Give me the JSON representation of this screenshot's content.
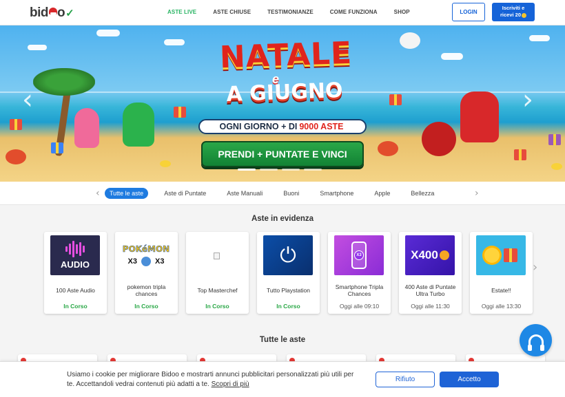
{
  "header": {
    "logo_text": "bid",
    "nav": [
      {
        "label": "ASTE LIVE",
        "active": true
      },
      {
        "label": "ASTE CHIUSE",
        "active": false
      },
      {
        "label": "TESTIMONIANZE",
        "active": false
      },
      {
        "label": "COME FUNZIONA",
        "active": false
      },
      {
        "label": "SHOP",
        "active": false
      }
    ],
    "login_label": "LOGIN",
    "signup_line1": "Iscriviti e",
    "signup_line2": "ricevi 20"
  },
  "banner": {
    "title": "NATALE",
    "title_e": "e",
    "subtitle": "A GIUGNO",
    "daily_prefix": "OGNI GIORNO + DI",
    "daily_highlight": "9000 ASTE",
    "cta": "PRENDI + PUNTATE E VINCI"
  },
  "categories": {
    "items": [
      "Tutte le aste",
      "Aste di Puntate",
      "Aste Manuali",
      "Buoni",
      "Smartphone",
      "Apple",
      "Bellezza"
    ],
    "active_index": 0
  },
  "featured": {
    "title": "Aste in evidenza",
    "cards": [
      {
        "name": "100 Aste Audio",
        "status": "In Corso",
        "thumb_text": "AUDIO"
      },
      {
        "name": "pokemon tripla chances",
        "status": "In Corso",
        "thumb_text": "POKéMON",
        "thumb_sub_left": "X3",
        "thumb_sub_right": "X3"
      },
      {
        "name": "Top Masterchef",
        "status": "In Corso"
      },
      {
        "name": "Tutto Playstation",
        "status": "In Corso"
      },
      {
        "name": "Smartphone Tripla Chances",
        "status": "Oggi alle 09:10",
        "thumb_text": "X3"
      },
      {
        "name": "400 Aste di Puntate Ultra Turbo",
        "status": "Oggi alle 11:30",
        "thumb_text": "X400"
      },
      {
        "name": "Estate!!",
        "status": "Oggi alle 13:30"
      }
    ]
  },
  "all_auctions": {
    "title": "Tutte le aste"
  },
  "cookie": {
    "text": "Usiamo i cookie per migliorare Bidoo e mostrarti annunci pubblicitari personalizzati più utili per te. Accettandoli vedrai contenuti più adatti a te.",
    "link": "Scopri di più",
    "reject_label": "Rifiuto",
    "accept_label": "Accetto"
  },
  "colors": {
    "brand_blue": "#1563d8",
    "live_green": "#28b463",
    "accent_red": "#e0241c"
  }
}
